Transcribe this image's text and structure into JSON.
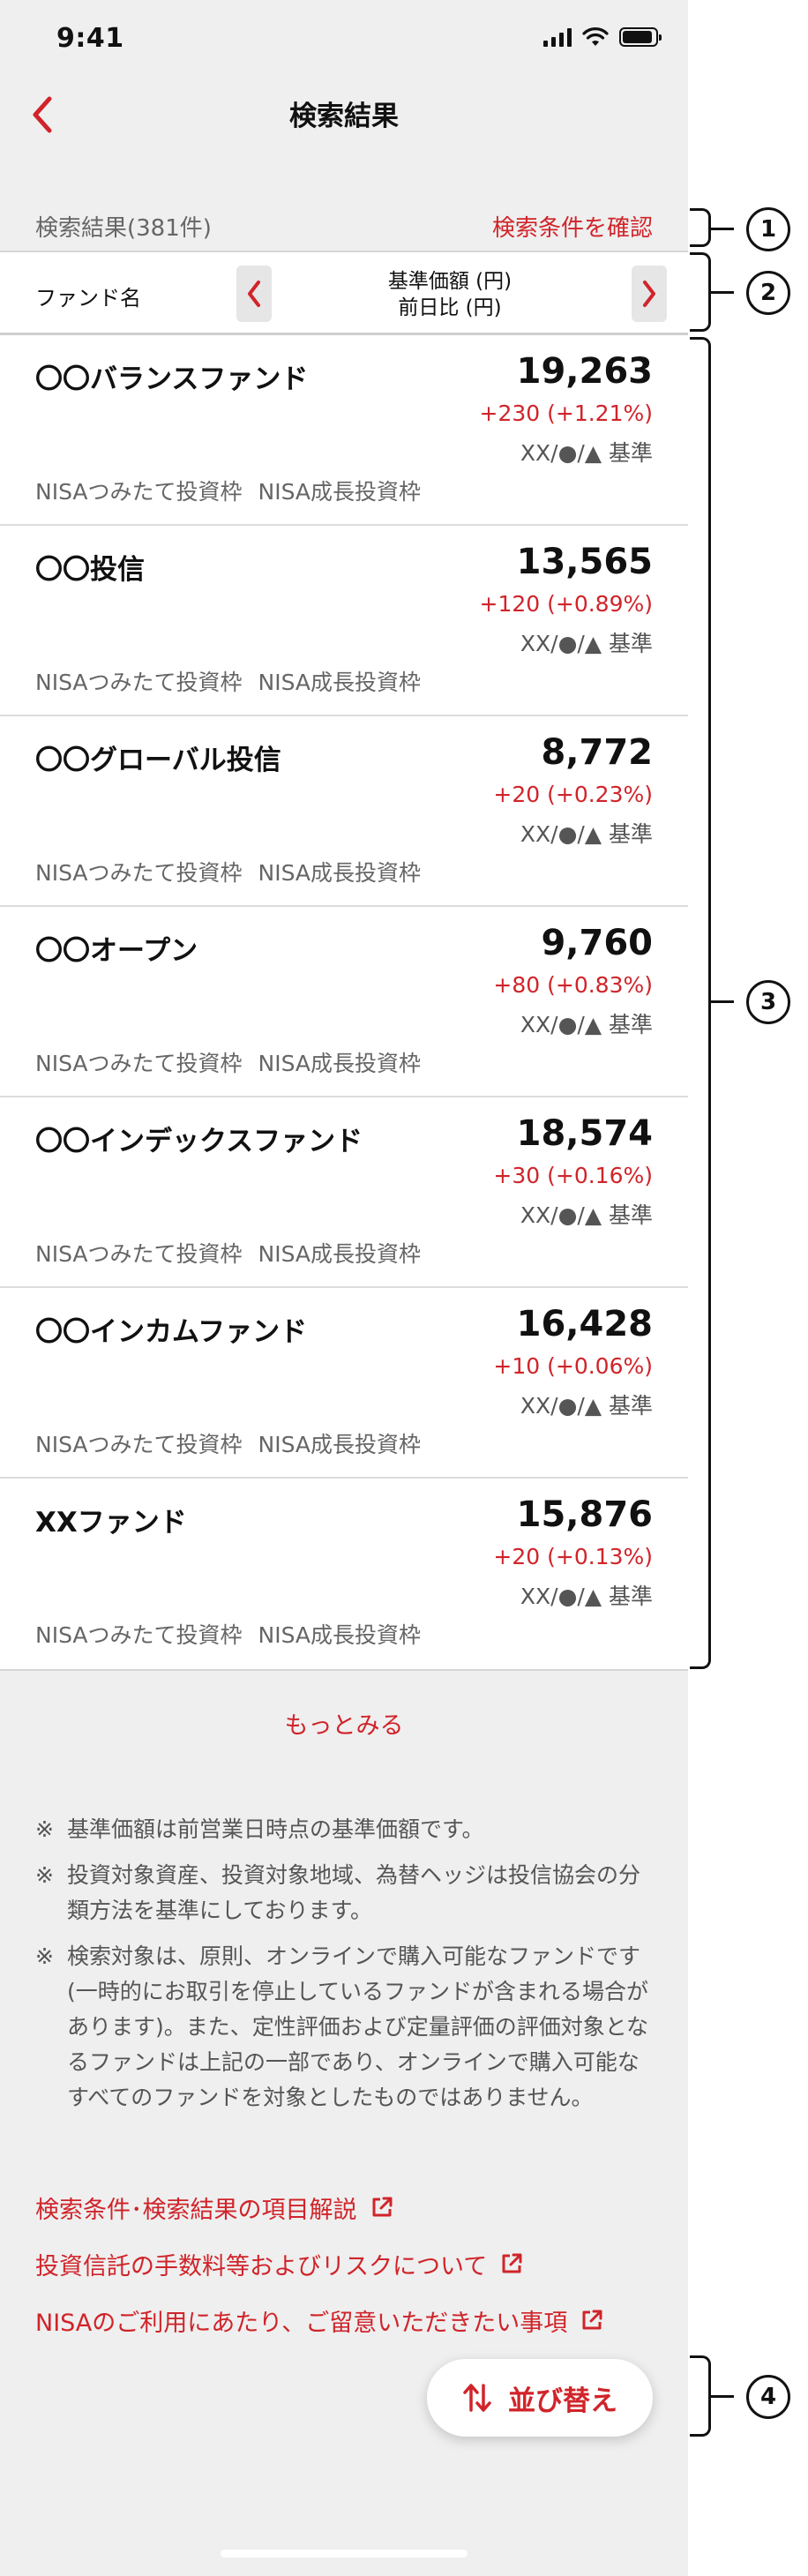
{
  "status_bar": {
    "time": "9:41"
  },
  "nav": {
    "title": "検索結果",
    "back_icon": "chevron-left-icon"
  },
  "summary": {
    "result_count": "検索結果(381件)",
    "confirm_link": "検索条件を確認"
  },
  "list_header": {
    "name_label": "ファンド名",
    "column_line1": "基準価額 (円)",
    "column_line2": "前日比 (円)"
  },
  "funds": [
    {
      "name": "〇〇バランスファンド",
      "price": "19,263",
      "change": "+230 (+1.21%)",
      "date": "XX/●/▲ 基準",
      "tags": [
        "NISAつみたて投資枠",
        "NISA成長投資枠"
      ]
    },
    {
      "name": "〇〇投信",
      "price": "13,565",
      "change": "+120 (+0.89%)",
      "date": "XX/●/▲ 基準",
      "tags": [
        "NISAつみたて投資枠",
        "NISA成長投資枠"
      ]
    },
    {
      "name": "〇〇グローバル投信",
      "price": "8,772",
      "change": "+20 (+0.23%)",
      "date": "XX/●/▲ 基準",
      "tags": [
        "NISAつみたて投資枠",
        "NISA成長投資枠"
      ]
    },
    {
      "name": "〇〇オープン",
      "price": "9,760",
      "change": "+80 (+0.83%)",
      "date": "XX/●/▲ 基準",
      "tags": [
        "NISAつみたて投資枠",
        "NISA成長投資枠"
      ]
    },
    {
      "name": "〇〇インデックスファンド",
      "price": "18,574",
      "change": "+30 (+0.16%)",
      "date": "XX/●/▲ 基準",
      "tags": [
        "NISAつみたて投資枠",
        "NISA成長投資枠"
      ]
    },
    {
      "name": "〇〇インカムファンド",
      "price": "16,428",
      "change": "+10 (+0.06%)",
      "date": "XX/●/▲ 基準",
      "tags": [
        "NISAつみたて投資枠",
        "NISA成長投資枠"
      ]
    },
    {
      "name": "XXファンド",
      "price": "15,876",
      "change": "+20 (+0.13%)",
      "date": "XX/●/▲ 基準",
      "tags": [
        "NISAつみたて投資枠",
        "NISA成長投資枠"
      ]
    }
  ],
  "more_link": "もっとみる",
  "notes": [
    {
      "mark": "※",
      "text": "基準価額は前営業日時点の基準価額です。"
    },
    {
      "mark": "※",
      "text": "投資対象資産、投資対象地域、為替ヘッジは投信協会の分類方法を基準にしております。"
    },
    {
      "mark": "※",
      "text": "検索対象は、原則、オンラインで購入可能なファンドです (一時的にお取引を停止しているファンドが含まれる場合があります)。また、定性評価および定量評価の評価対象となるファンドは上記の一部であり、オンラインで購入可能なすべてのファンドを対象としたものではありません。"
    }
  ],
  "links": [
    {
      "label": "検索条件･検索結果の項目解説",
      "icon": "external-link-icon"
    },
    {
      "label": "投資信託の手数料等およびリスクについて",
      "icon": "external-link-icon"
    },
    {
      "label": "NISAのご利用にあたり、ご留意いただきたい事項",
      "icon": "external-link-icon"
    }
  ],
  "sort_button": {
    "label": "並び替え",
    "icon": "sort-arrows-icon"
  },
  "annotations": [
    "1",
    "2",
    "3",
    "4"
  ],
  "colors": {
    "accent": "#d0242a",
    "background": "#efefef",
    "card": "#ffffff"
  }
}
